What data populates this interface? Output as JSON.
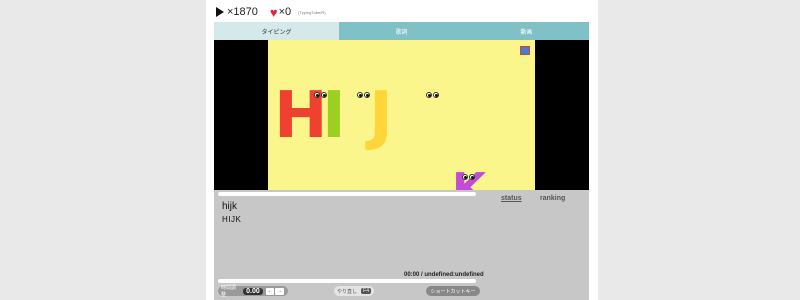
{
  "stats": {
    "play_icon": "play-icon",
    "play_count": "×1870",
    "heart_icon": "heart-icon",
    "heart_glyph": "♥",
    "like_count": "×0",
    "channel": "(TypingTube/R)"
  },
  "tabs": [
    {
      "label": "タイピング",
      "active": true
    },
    {
      "label": "歌詞",
      "active": false
    },
    {
      "label": "動画",
      "active": false
    }
  ],
  "video": {
    "letters": [
      "H",
      "I",
      "J",
      "K"
    ],
    "colors": {
      "h": "#f0402f",
      "i": "#9ccf21",
      "j": "#fed63a",
      "k": "#c54ad8",
      "background": "#fbf68b"
    }
  },
  "panel": {
    "word": "hijk",
    "word_upper": "HIJK",
    "status_link": "status",
    "ranking_link": "ranking",
    "time": "00:00 / undefined:undefined",
    "top_progress": 0,
    "bottom_progress": 0
  },
  "controls": {
    "speed_label": "時間調整",
    "speed_value": "0.00",
    "speed_down": "←",
    "speed_up": "→",
    "redo_label": "やり直し",
    "redo_key": "F4",
    "shortcut_label": "ショートカットキー"
  },
  "accent": "#7fc1c6"
}
